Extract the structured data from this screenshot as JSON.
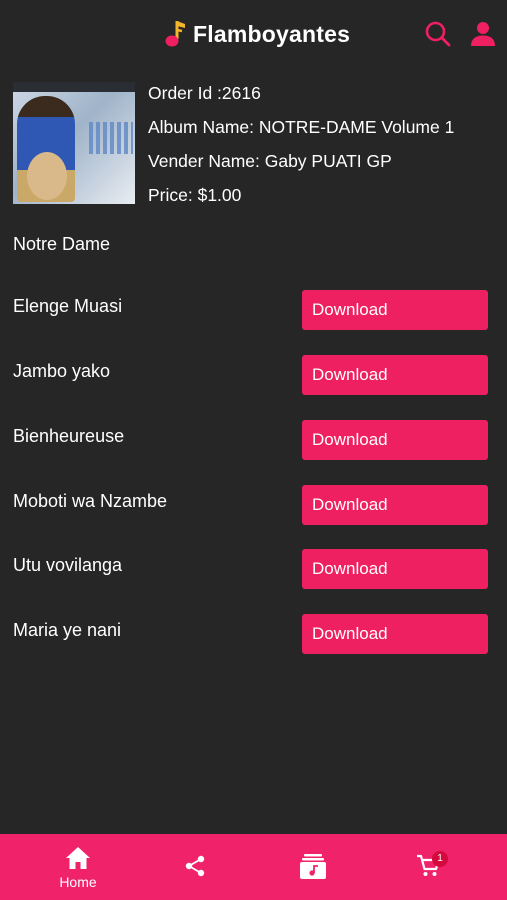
{
  "header": {
    "title": "Flamboyantes"
  },
  "order": {
    "order_id": "Order Id :2616",
    "album_name": "Album Name: NOTRE-DAME Volume 1",
    "vendor_name": "Vender Name: Gaby PUATI GP",
    "price": "Price: $1.00"
  },
  "album_heading": "Notre Dame",
  "tracks": [
    {
      "title": "Elenge Muasi",
      "button": "Download"
    },
    {
      "title": "Jambo yako",
      "button": "Download"
    },
    {
      "title": "Bienheureuse",
      "button": "Download"
    },
    {
      "title": "Moboti wa Nzambe",
      "button": "Download"
    },
    {
      "title": "Utu vovilanga",
      "button": "Download"
    },
    {
      "title": "Maria ye nani",
      "button": "Download"
    }
  ],
  "bottom_nav": {
    "home_label": "Home",
    "cart_count": "1"
  },
  "icons": {
    "brand": "music-note-icon",
    "search": "search-icon",
    "user": "user-icon",
    "home": "home-icon",
    "share": "share-icon",
    "album": "album-icon",
    "cart": "cart-icon"
  },
  "colors": {
    "background": "#272627",
    "accent": "#ef2062",
    "nav_bar": "#f0226a",
    "text": "#ffffff"
  }
}
